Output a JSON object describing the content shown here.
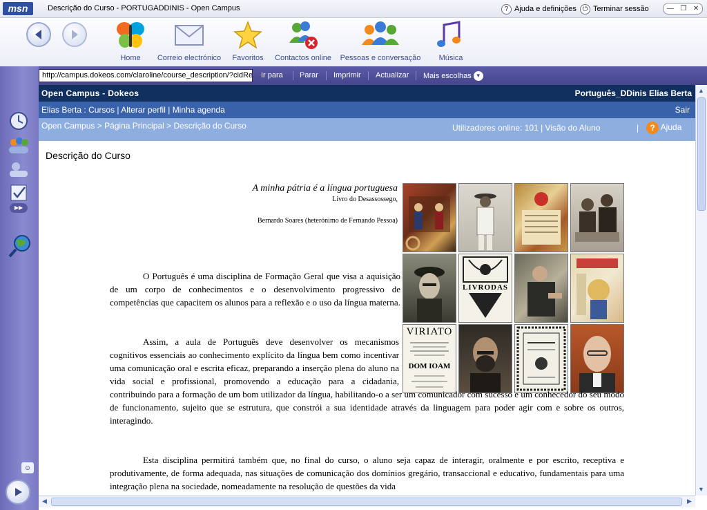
{
  "window": {
    "logo": "msn",
    "title": "Descrição do Curso - PORTUGADDINIS - Open Campus",
    "help": "Ajuda e definições",
    "signout": "Terminar sessão"
  },
  "toolbar": {
    "items": [
      {
        "label": "Home"
      },
      {
        "label": "Correio electrónico"
      },
      {
        "label": "Favoritos"
      },
      {
        "label": "Contactos online"
      },
      {
        "label": "Pessoas e conversação"
      },
      {
        "label": "Música"
      }
    ]
  },
  "addressbar": {
    "url": "http://campus.dokeos.com/claroline/course_description/?cidRe",
    "go": "Ir para",
    "stop": "Parar",
    "print": "Imprimir",
    "refresh": "Actualizar",
    "more": "Mais escolhas"
  },
  "header": {
    "site": "Open Campus - Dokeos",
    "course": "Português_DDinis Elias Berta"
  },
  "usernav": {
    "user": "Elias Berta",
    "sep": ":",
    "courses": "Cursos",
    "profile": "Alterar perfil",
    "agenda": "Minha agenda",
    "logout": "Sair"
  },
  "breadcrumb": {
    "home": "Open Campus",
    "principal": "Página Principal",
    "current": "Descrição do Curso",
    "online": "Utilizadores online: 101",
    "student_view": "Visão do Aluno",
    "help": "Ajuda"
  },
  "page": {
    "heading": "Descrição do Curso",
    "quote": "A minha pátria é a língua portuguesa",
    "source": "Livro do Desassossego,",
    "author": "Bernardo Soares (heterónimo de Fernando Pessoa)",
    "p1": "O Português é uma disciplina de Formação Geral que visa a aquisição de um corpo de conhecimentos e o desenvolvimento progressivo de competências que capacitem os alunos para a reflexão e o uso da língua materna.",
    "p2": "Assim, a aula de Português deve desenvolver os mecanismos cognitivos essenciais ao conhecimento explícito da língua bem como incentivar uma comunicação oral e escrita eficaz, preparando a inserção plena do aluno na vida social e profissional, promovendo a educação para a cidadania, contribuindo para a formação de um bom utilizador da língua, habilitando-o a ser um comunicador com sucesso e um conhecedor do seu modo de funcionamento, sujeito que se estrutura, que constrói a sua identidade através da linguagem para poder agir com e sobre os outros, interagindo.",
    "p3": "Esta disciplina permitirá também que, no final do curso, o aluno seja capaz de interagir, oralmente e por escrito, receptiva e produtivamente, de forma adequada, nas situações de comunicação dos domínios gregário, transaccional e educativo, fundamentais para uma integração plena na sociedade, nomeadamente na resolução de questões da vida",
    "images": [
      {
        "name": "image-medieval-musicians"
      },
      {
        "name": "image-man-white-suit"
      },
      {
        "name": "image-illuminated-manuscript"
      },
      {
        "name": "image-two-men-portrait"
      },
      {
        "name": "image-pessoa-portrait"
      },
      {
        "name": "image-livrodas-cover",
        "text": "LIVRODAS"
      },
      {
        "name": "image-man-painting"
      },
      {
        "name": "image-illustrated-page"
      },
      {
        "name": "image-viriato-tragico-cover",
        "text": "VIRIATO",
        "text2": "DOM IOAM"
      },
      {
        "name": "image-bearded-writer"
      },
      {
        "name": "image-ornate-title-page"
      },
      {
        "name": "image-saramago-portrait"
      }
    ]
  }
}
